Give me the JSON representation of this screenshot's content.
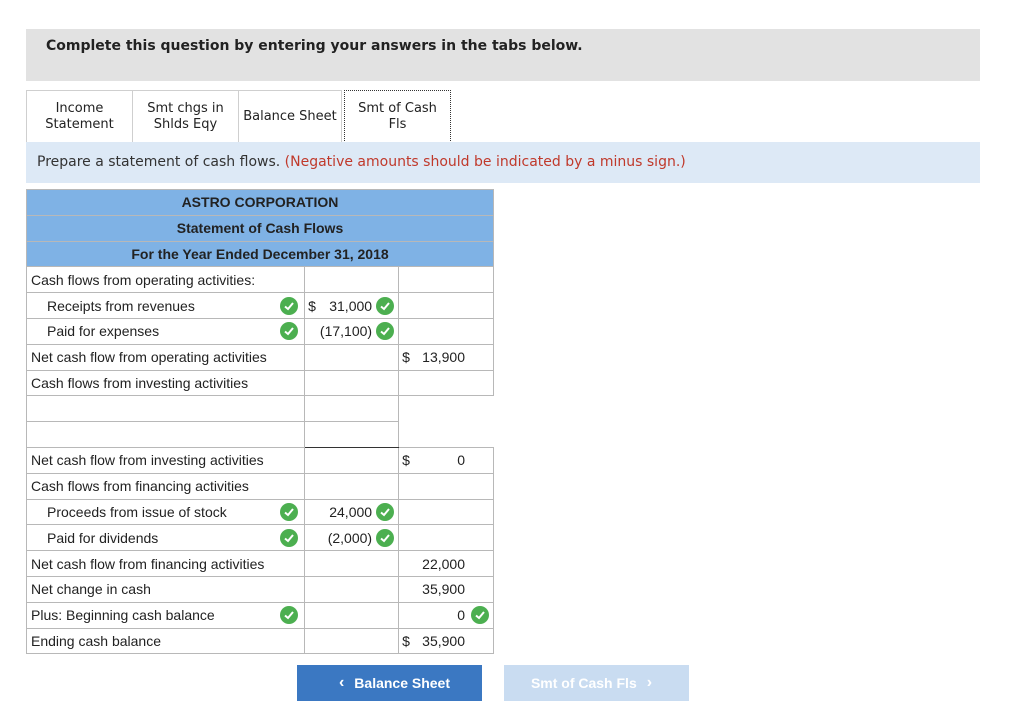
{
  "instruction": "Complete this question by entering your answers in the tabs below.",
  "tabs": [
    {
      "label_line1": "Income",
      "label_line2": "Statement"
    },
    {
      "label_line1": "Smt chgs in",
      "label_line2": "Shlds Eqy"
    },
    {
      "label_line1": "Balance Sheet",
      "label_line2": ""
    },
    {
      "label_line1": "Smt of Cash",
      "label_line2": "Fls",
      "active": true
    }
  ],
  "prompt": {
    "text": "Prepare a statement of cash flows.",
    "note": "(Negative amounts should be indicated by a minus sign.)"
  },
  "statement": {
    "company": "ASTRO CORPORATION",
    "title": "Statement of Cash Flows",
    "period": "For the Year Ended December 31, 2018",
    "rows": {
      "op_header": "Cash flows from operating activities:",
      "receipts_label": "Receipts from revenues",
      "receipts_value": "31,000",
      "paid_expenses_label": "Paid for expenses",
      "paid_expenses_value": "(17,100)",
      "net_op_label": "Net cash flow from operating activities",
      "net_op_value": "13,900",
      "inv_header": "Cash flows from investing activities",
      "inv_blank1_label": "",
      "inv_blank1_value": "",
      "inv_blank2_label": "",
      "inv_blank2_value": "",
      "net_inv_label": "Net cash flow from investing activities",
      "net_inv_value": "0",
      "fin_header": "Cash flows from financing activities",
      "stock_label": "Proceeds from issue of stock",
      "stock_value": "24,000",
      "dividends_label": "Paid for dividends",
      "dividends_value": "(2,000)",
      "net_fin_label": "Net cash flow from financing activities",
      "net_fin_value": "22,000",
      "net_change_label": "Net change in cash",
      "net_change_value": "35,900",
      "begin_label": "Plus: Beginning cash balance",
      "begin_value": "0",
      "end_label": "Ending cash balance",
      "end_value": "35,900"
    },
    "currency_symbol": "$"
  },
  "nav": {
    "prev_label": "Balance Sheet",
    "next_label": "Smt of Cash Fls"
  },
  "colors": {
    "header_blue": "#7fb2e5",
    "check_green": "#4caf50",
    "prev_button": "#3b78c2",
    "next_button_disabled": "#c9dcf1",
    "note_red": "#c0392b"
  }
}
